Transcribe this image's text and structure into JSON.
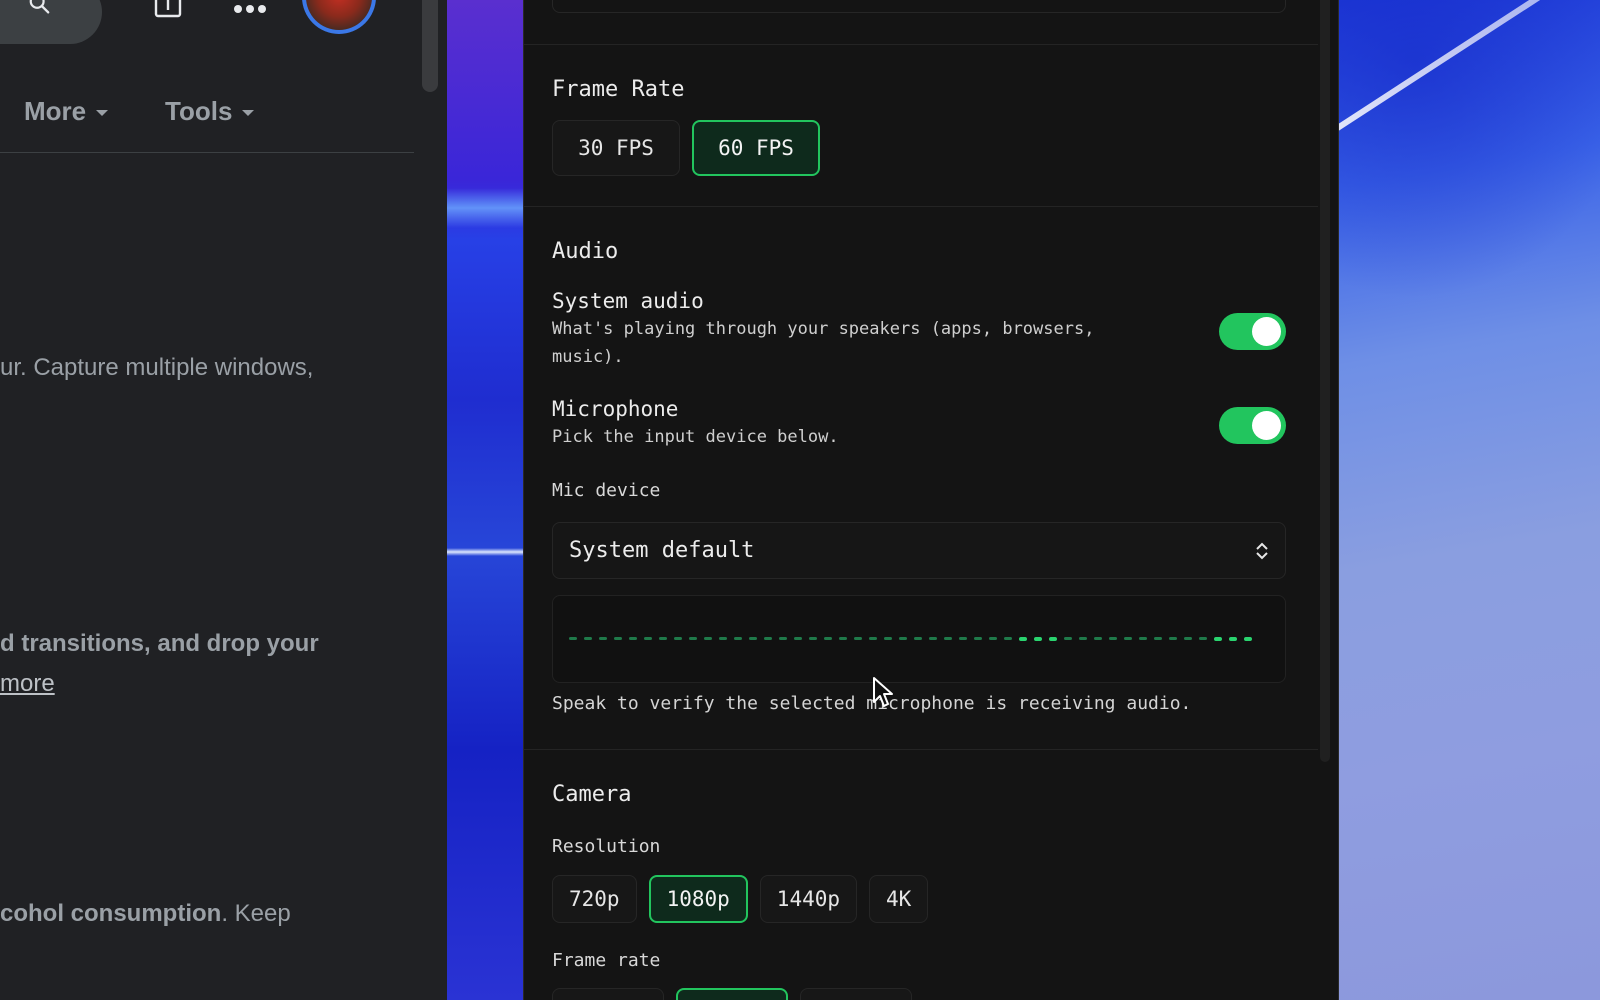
{
  "browser": {
    "nav": [
      {
        "label": "More"
      },
      {
        "label": "Tools"
      }
    ],
    "snippets": {
      "line1": "ur. Capture multiple windows,",
      "line2_bold": "d transitions, and drop your",
      "line3_link": "more",
      "line4_bold": "cohol consumption",
      "line4_rest": ". Keep"
    }
  },
  "panel": {
    "frame_rate": {
      "title": "Frame Rate",
      "options": [
        "30 FPS",
        "60 FPS"
      ],
      "selected": "60 FPS"
    },
    "audio": {
      "title": "Audio",
      "system_audio": {
        "title": "System audio",
        "description": "What's playing through your speakers (apps, browsers, music).",
        "enabled": true
      },
      "microphone": {
        "title": "Microphone",
        "description": "Pick the input device below.",
        "enabled": true
      },
      "mic_device": {
        "label": "Mic device",
        "value": "System default"
      },
      "meter_hint": "Speak to verify the selected microphone is receiving audio."
    },
    "camera": {
      "title": "Camera",
      "resolution": {
        "label": "Resolution",
        "options": [
          "720p",
          "1080p",
          "1440p",
          "4K"
        ],
        "selected": "1080p"
      },
      "frame_rate_label": "Frame rate"
    }
  },
  "colors": {
    "accent": "#22c55e",
    "panel_bg": "#141414",
    "browser_bg": "#202124"
  }
}
